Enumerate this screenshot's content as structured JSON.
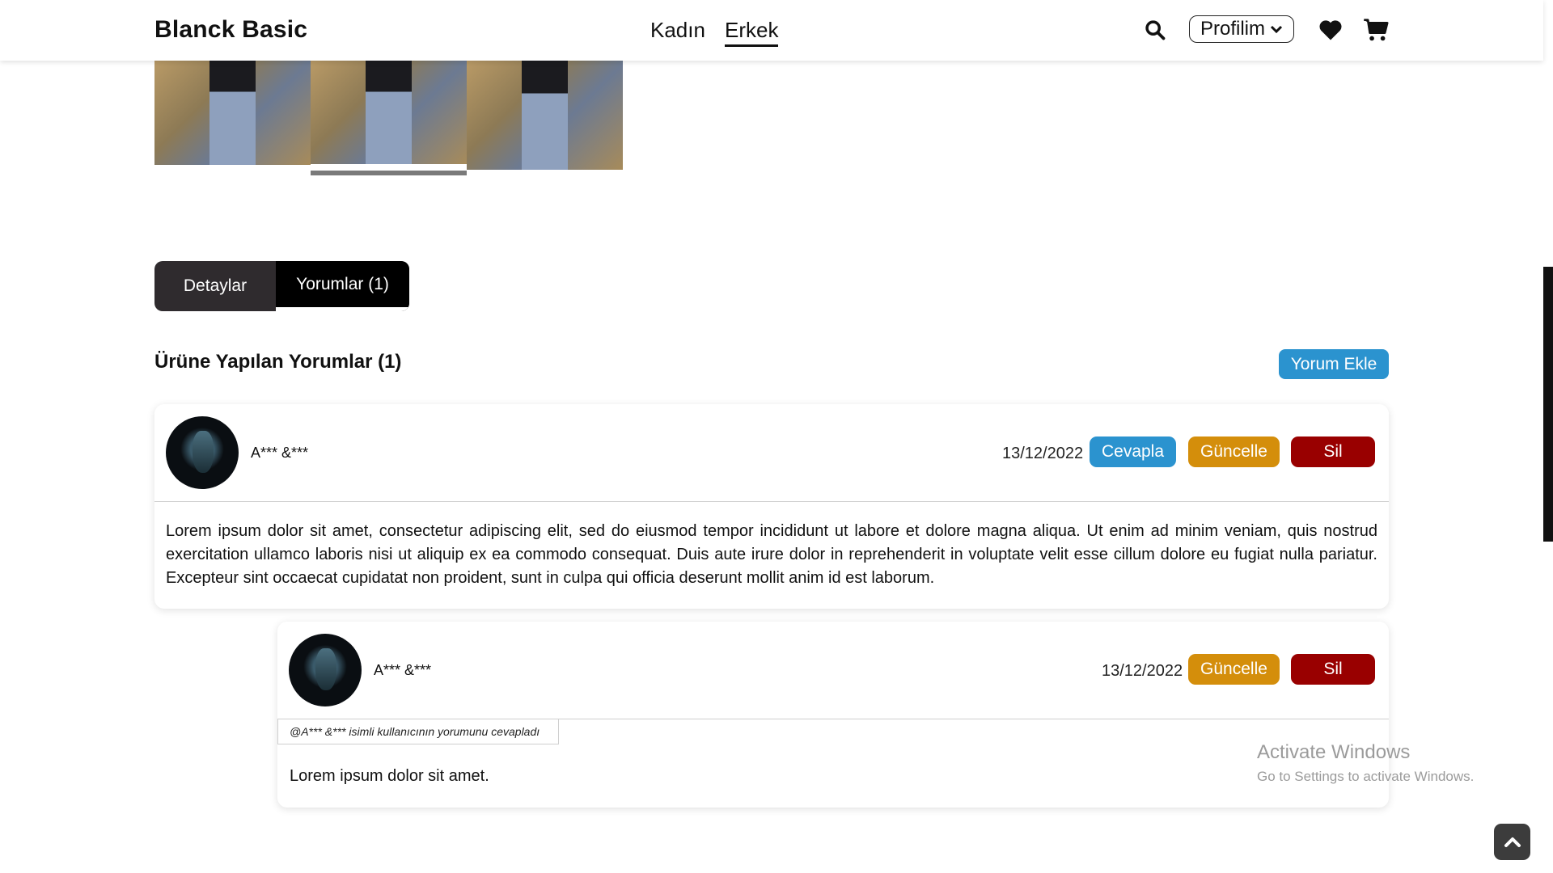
{
  "header": {
    "brand": "Blanck Basic",
    "nav": {
      "women": "Kadın",
      "men": "Erkek"
    },
    "profile_label": "Profilim",
    "icons": [
      "search-icon",
      "chevron-down-icon",
      "heart-icon",
      "cart-icon"
    ]
  },
  "tabs": {
    "details": "Detaylar",
    "comments": "Yorumlar (1)"
  },
  "comments_section": {
    "title": "Ürüne Yapılan Yorumlar (1)",
    "add_button": "Yorum Ekle"
  },
  "comments": [
    {
      "user": "A*** &***",
      "date": "13/12/2022",
      "actions": {
        "reply": "Cevapla",
        "update": "Güncelle",
        "delete": "Sil"
      },
      "text": "Lorem ipsum dolor sit amet, consectetur adipiscing elit, sed do eiusmod tempor incididunt ut labore et dolore magna aliqua. Ut enim ad minim veniam, quis nostrud exercitation ullamco laboris nisi ut aliquip ex ea commodo consequat. Duis aute irure dolor in reprehenderit in voluptate velit esse cillum dolore eu fugiat nulla pariatur. Excepteur sint occaecat cupidatat non proident, sunt in culpa qui officia deserunt mollit anim id est laborum."
    }
  ],
  "reply": {
    "user": "A*** &***",
    "date": "13/12/2022",
    "actions": {
      "update": "Güncelle",
      "delete": "Sil"
    },
    "tag": "@A*** &*** isimli kullanıcının yorumunu cevapladı",
    "text": "Lorem ipsum dolor sit amet."
  },
  "watermark": {
    "title": "Activate Windows",
    "subtitle": "Go to Settings to activate Windows."
  },
  "colors": {
    "blue": "#2b93cf",
    "orange": "#d48e0b",
    "red": "#990000",
    "dark": "#2f2b2e"
  }
}
